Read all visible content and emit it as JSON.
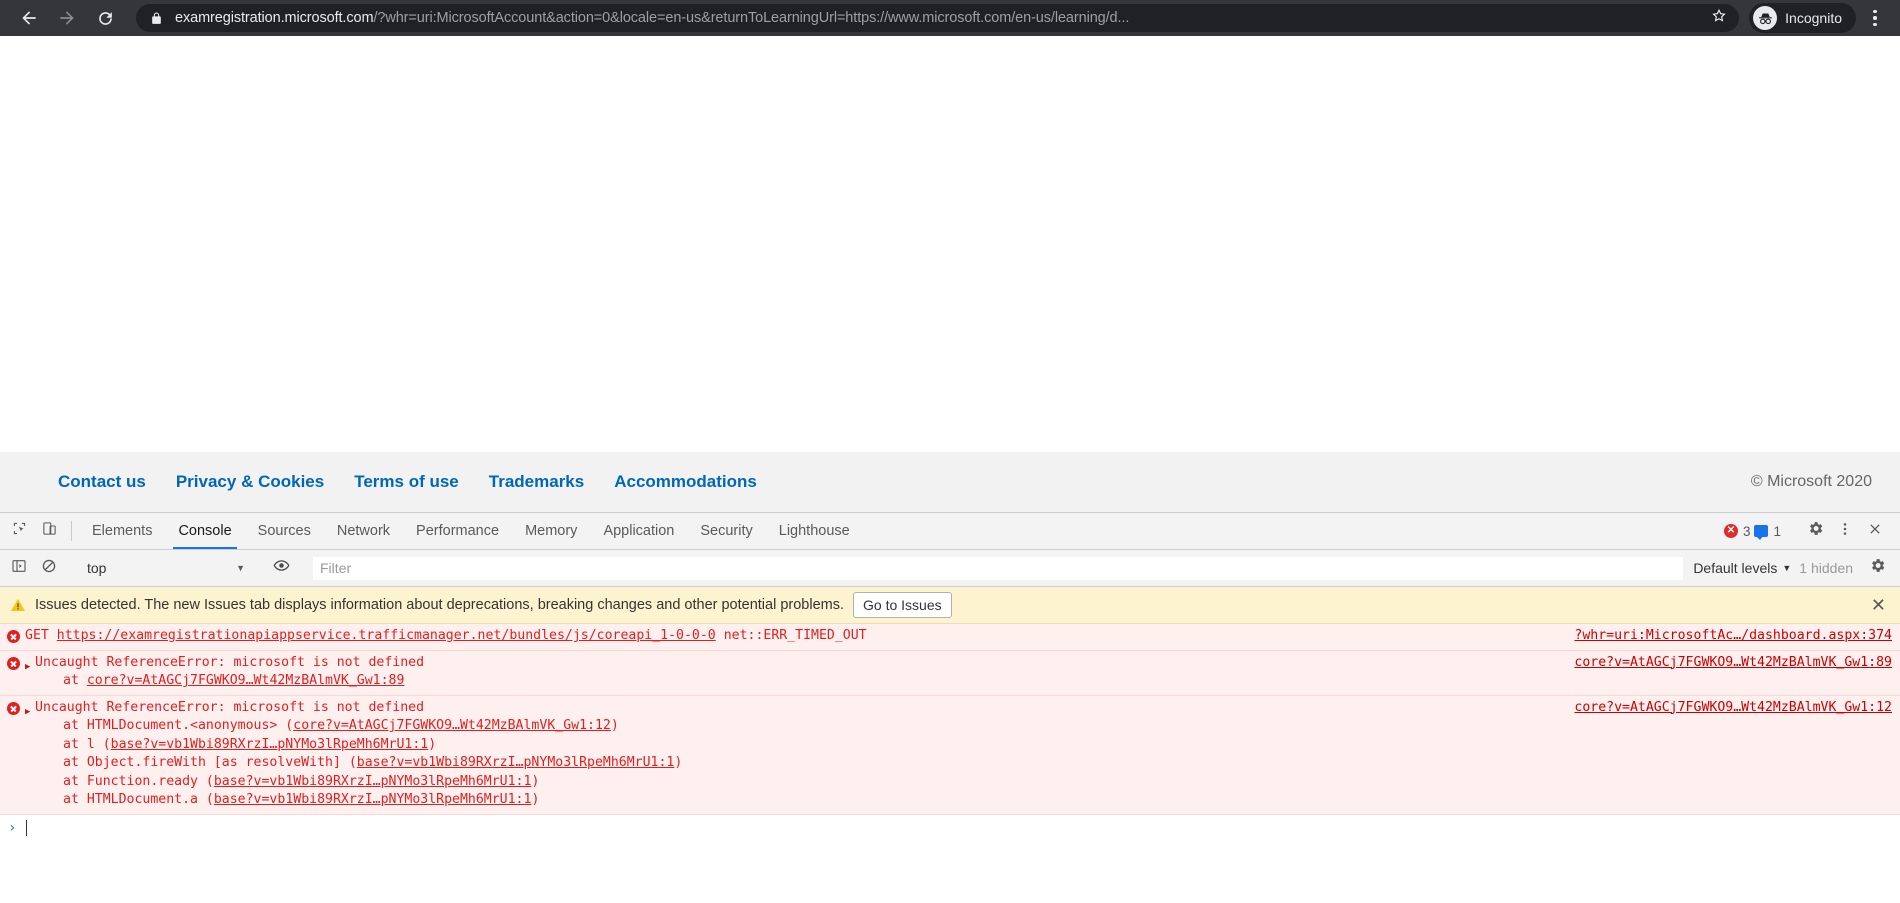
{
  "browser": {
    "back_icon": "back-arrow-icon",
    "forward_icon": "forward-arrow-icon",
    "reload_icon": "reload-icon",
    "lock_icon": "lock-icon",
    "url_host": "examregistration.microsoft.com",
    "url_path": "/?whr=uri:MicrosoftAccount&action=0&locale=en-us&returnToLearningUrl=https://www.microsoft.com/en-us/learning/d...",
    "star_icon": "bookmark-star-icon",
    "profile_label": "Incognito",
    "profile_icon": "incognito-hat-icon",
    "menu_icon": "kebab-menu-icon"
  },
  "page_footer": {
    "links": [
      "Contact us",
      "Privacy & Cookies",
      "Terms of use",
      "Trademarks",
      "Accommodations"
    ],
    "copyright": "© Microsoft 2020"
  },
  "devtools": {
    "inspect_icon": "inspect-element-icon",
    "device_icon": "device-toolbar-icon",
    "tabs": [
      {
        "label": "Elements",
        "active": false
      },
      {
        "label": "Console",
        "active": true
      },
      {
        "label": "Sources",
        "active": false
      },
      {
        "label": "Network",
        "active": false
      },
      {
        "label": "Performance",
        "active": false
      },
      {
        "label": "Memory",
        "active": false
      },
      {
        "label": "Application",
        "active": false
      },
      {
        "label": "Security",
        "active": false
      },
      {
        "label": "Lighthouse",
        "active": false
      }
    ],
    "error_count": "3",
    "message_count": "1",
    "settings_icon": "gear-icon",
    "more_icon": "kebab-menu-icon",
    "close_icon": "close-icon",
    "console_toolbar": {
      "sidebar_icon": "console-sidebar-icon",
      "clear_icon": "clear-console-icon",
      "context": "top",
      "context_caret": "▼",
      "eye_icon": "live-expression-eye-icon",
      "filter_placeholder": "Filter",
      "filter_value": "",
      "levels_label": "Default levels",
      "levels_caret": "▼",
      "hidden_label": "1 hidden",
      "settings_icon": "gear-icon"
    },
    "issues_banner": {
      "warning_icon": "warning-triangle-icon",
      "text": "Issues detected. The new Issues tab displays information about deprecations, breaking changes and other potential problems.",
      "button_label": "Go to Issues",
      "close_icon": "close-icon"
    },
    "messages": [
      {
        "icon": "error-circle-icon",
        "expandable": false,
        "prefix": "GET ",
        "link": "https://examregistrationapiappservice.trafficmanager.net/bundles/js/coreapi_1-0-0-0",
        "suffix": " net::ERR_TIMED_OUT",
        "stack": [],
        "source": "?whr=uri:MicrosoftAc…/dashboard.aspx:374"
      },
      {
        "icon": "error-circle-icon",
        "expandable": true,
        "prefix": "Uncaught ReferenceError: microsoft is not defined",
        "link": "",
        "suffix": "",
        "stack": [
          {
            "text": "    at ",
            "link": "core?v=AtAGCj7FGWKO9…Wt42MzBAlmVK_Gw1:89",
            "after": ""
          }
        ],
        "source": "core?v=AtAGCj7FGWKO9…Wt42MzBAlmVK_Gw1:89"
      },
      {
        "icon": "error-circle-icon",
        "expandable": true,
        "prefix": "Uncaught ReferenceError: microsoft is not defined",
        "link": "",
        "suffix": "",
        "stack": [
          {
            "text": "    at HTMLDocument.<anonymous> (",
            "link": "core?v=AtAGCj7FGWKO9…Wt42MzBAlmVK_Gw1:12",
            "after": ")"
          },
          {
            "text": "    at l (",
            "link": "base?v=vb1Wbi89RXrzI…pNYMo3lRpeMh6MrU1:1",
            "after": ")"
          },
          {
            "text": "    at Object.fireWith [as resolveWith] (",
            "link": "base?v=vb1Wbi89RXrzI…pNYMo3lRpeMh6MrU1:1",
            "after": ")"
          },
          {
            "text": "    at Function.ready (",
            "link": "base?v=vb1Wbi89RXrzI…pNYMo3lRpeMh6MrU1:1",
            "after": ")"
          },
          {
            "text": "    at HTMLDocument.a (",
            "link": "base?v=vb1Wbi89RXrzI…pNYMo3lRpeMh6MrU1:1",
            "after": ")"
          }
        ],
        "source": "core?v=AtAGCj7FGWKO9…Wt42MzBAlmVK_Gw1:12"
      }
    ],
    "prompt": {
      "caret": "›",
      "value": ""
    }
  },
  "colors": {
    "chrome_bg": "#35363a",
    "omnibox_bg": "#202124",
    "link_blue": "#0067b8",
    "error_red": "#e02020",
    "error_row_bg": "#fff0f0",
    "banner_bg": "#fdf4cf",
    "tab_active": "#1a73e8"
  }
}
